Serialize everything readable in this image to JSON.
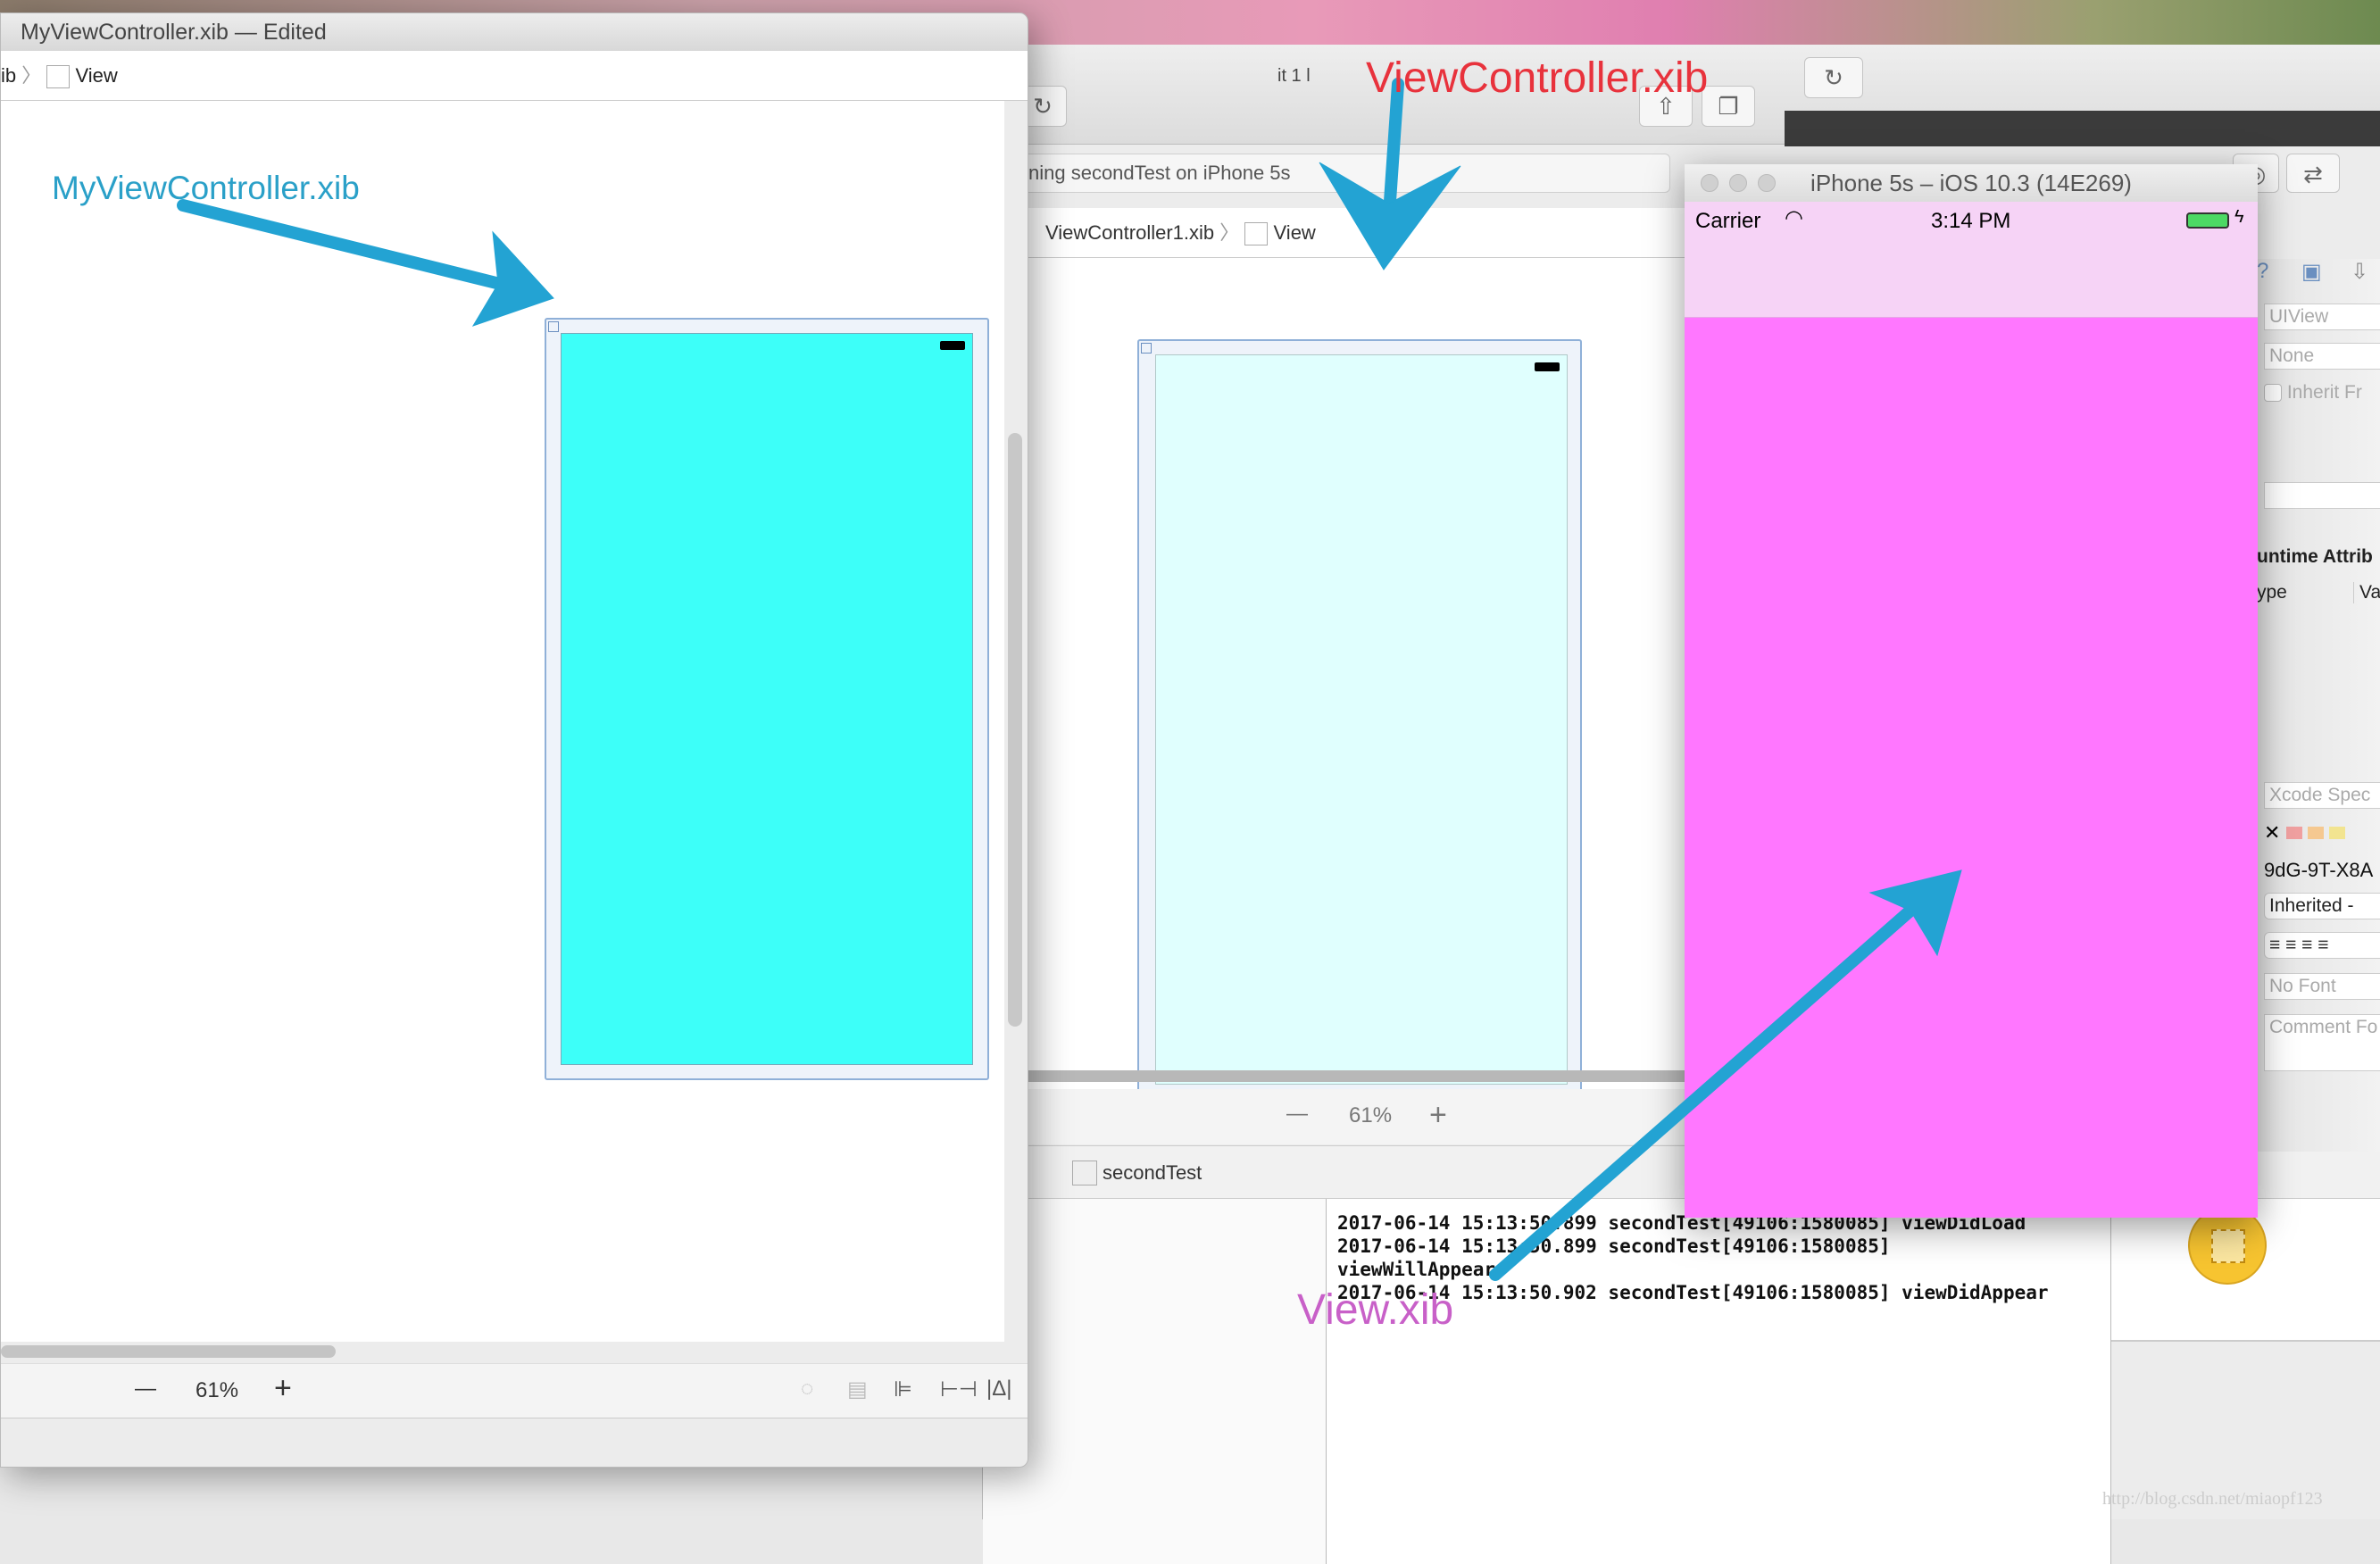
{
  "front_window": {
    "title": "MyViewController.xib — Edited",
    "breadcrumb": [
      "ib",
      "View"
    ],
    "zoom": "61%",
    "zoom_minus": "—",
    "zoom_plus": "+",
    "view_color": "#3dfff9"
  },
  "back_window": {
    "activity": "ning secondTest on iPhone 5s",
    "partial_title": "it 1 l",
    "breadcrumb": [
      "ViewController1.xib",
      "View"
    ],
    "zoom": "61%",
    "zoom_minus": "—",
    "zoom_plus": "+",
    "view_color": "#e0fffe",
    "debug_target": "secondTest",
    "console_lines": [
      "2017-06-14 15:13:50.899 secondTest[49106:1580085] viewDidLoad",
      "2017-06-14 15:13:50.899 secondTest[49106:1580085]",
      "viewWillAppear",
      "2017-06-14 15:13:50.902 secondTest[49106:1580085] viewDidAppear"
    ]
  },
  "inspector": {
    "class_field": "UIView",
    "module_field": "None",
    "inherit_checkbox": "Inherit Fr",
    "runtime_header": "untime Attrib",
    "col_type": "ype",
    "col_value": "Va",
    "spec_field": "Xcode Spec",
    "object_id": "9dG-9T-X8A",
    "inherited_popup": "Inherited -",
    "font_field": "No Font",
    "comment_field": "Comment Fo"
  },
  "simulator": {
    "title": "iPhone 5s – iOS 10.3 (14E269)",
    "carrier": "Carrier",
    "time": "3:14 PM",
    "view_color": "#ff77ff",
    "statusbar_color": "#f6d3f6"
  },
  "annotations": {
    "my_vc": "MyViewController.xib",
    "vc": "ViewController.xib",
    "view": "View.xib",
    "arrow_color": "#23a3d3"
  },
  "watermark": "http://blog.csdn.net/miaopf123"
}
